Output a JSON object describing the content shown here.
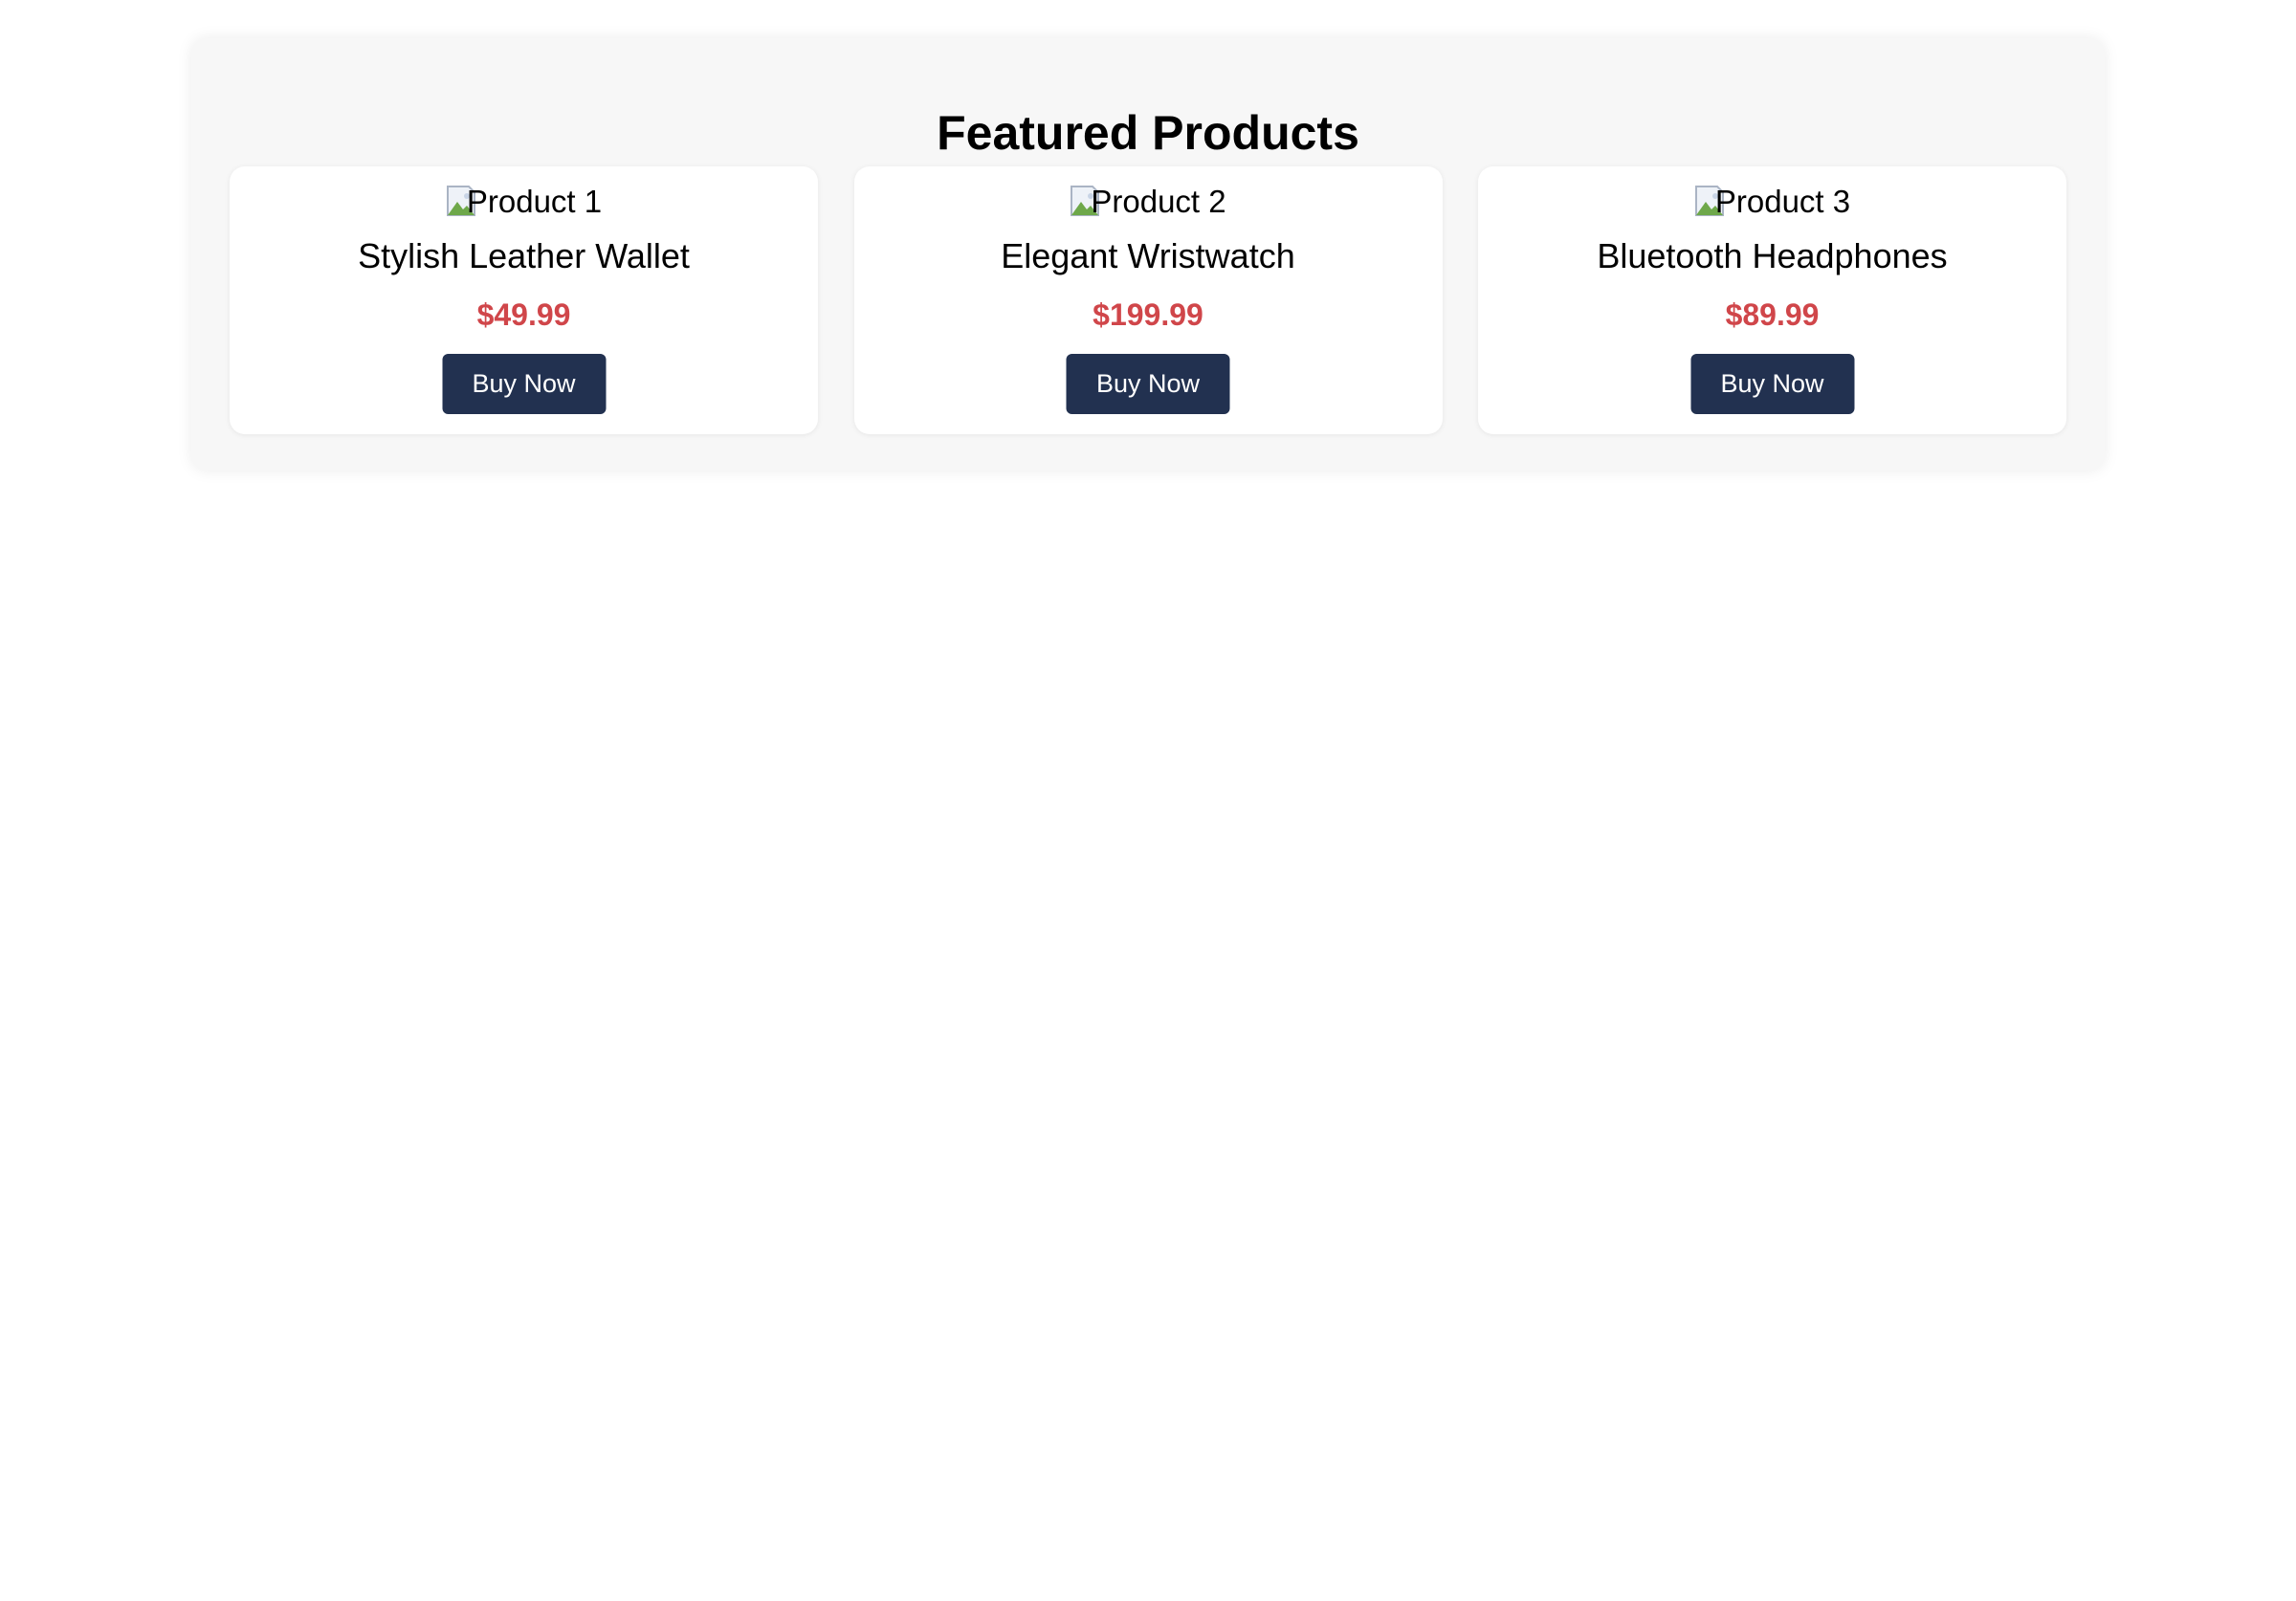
{
  "section": {
    "title": "Featured Products"
  },
  "products": [
    {
      "image_alt": "Product 1",
      "name": "Stylish Leather Wallet",
      "price": "$49.99",
      "button_label": "Buy Now"
    },
    {
      "image_alt": "Product 2",
      "name": "Elegant Wristwatch",
      "price": "$199.99",
      "button_label": "Buy Now"
    },
    {
      "image_alt": "Product 3",
      "name": "Bluetooth Headphones",
      "price": "$89.99",
      "button_label": "Buy Now"
    }
  ],
  "icons": {
    "image_placeholder": "broken-image-icon"
  },
  "colors": {
    "section_background": "#f7f7f7",
    "card_background": "#ffffff",
    "price": "#d0464a",
    "button_background": "#223150",
    "button_text": "#ffffff"
  }
}
